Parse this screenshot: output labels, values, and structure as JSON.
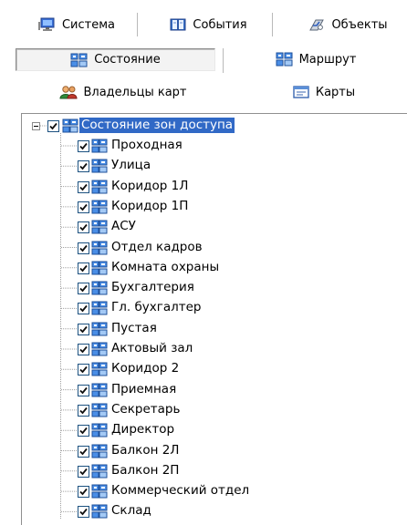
{
  "toolbar": {
    "system_label": "Система",
    "events_label": "События",
    "objects_label": "Объекты",
    "state_label": "Состояние",
    "route_label": "Маршрут",
    "card_owners_label": "Владельцы карт",
    "cards_label": "Карты"
  },
  "tree": {
    "root_label": "Состояние зон доступа",
    "items": [
      "Проходная",
      "Улица",
      "Коридор 1Л",
      "Коридор 1П",
      "АСУ",
      "Отдел кадров",
      "Комната охраны",
      "Бухгалтерия",
      "Гл. бухгалтер",
      "Пустая",
      "Актовый зал",
      "Коридор 2",
      "Приемная",
      "Секретарь",
      "Директор",
      "Балкон 2Л",
      "Балкон 2П",
      "Коммерческий отдел",
      "Склад"
    ]
  },
  "icons": {
    "system": "monitor-icon",
    "events": "book-icon",
    "objects": "objects-icon",
    "state": "zone-icon",
    "route": "zone-icon",
    "card_owners": "users-icon",
    "cards": "card-icon",
    "node": "zone-icon"
  },
  "colors": {
    "selection": "#3169c6",
    "checkbox_border": "#1c5180"
  }
}
